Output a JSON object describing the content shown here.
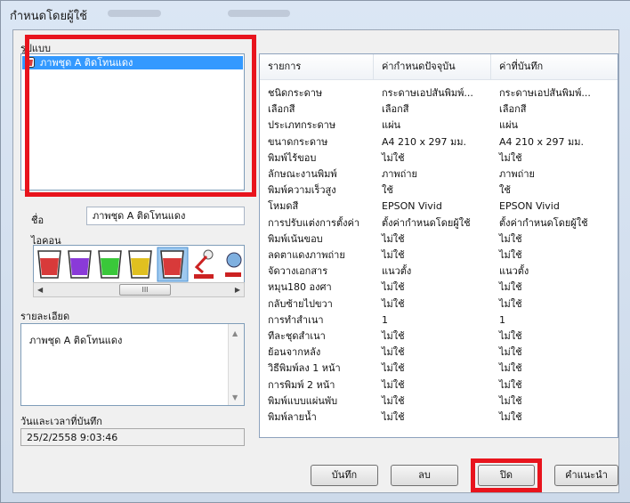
{
  "window": {
    "title": "กำหนดโดยผู้ใช้"
  },
  "format": {
    "label": "รูปแบบ",
    "items": [
      "ภาพชุด A ติดโทนแดง"
    ]
  },
  "name": {
    "label": "ชื่อ",
    "value": "ภาพชุด A ติดโทนแดง"
  },
  "icon": {
    "label": "ไอคอน",
    "colors": [
      "#d83a3a",
      "#8a3ad8",
      "#3ac83a",
      "#e0c020",
      "#d83a3a"
    ],
    "scroll_grip": "III"
  },
  "details": {
    "label": "รายละเอียด",
    "value": "ภาพชุด A ติดโทนแดง"
  },
  "saved": {
    "label": "วันและเวลาที่บันทึก",
    "value": "25/2/2558 9:03:46"
  },
  "table": {
    "headers": [
      "รายการ",
      "ค่ากำหนดปัจจุบัน",
      "ค่าที่บันทึก"
    ],
    "rows": [
      [
        "ชนิดกระดาษ",
        "กระดาษเอปสันพิมพ์...",
        "กระดาษเอปสันพิมพ์..."
      ],
      [
        "เลือกสี",
        "เลือกสี",
        "เลือกสี"
      ],
      [
        "ประเภทกระดาษ",
        "แผ่น",
        "แผ่น"
      ],
      [
        "ขนาดกระดาษ",
        "A4 210 x 297 มม.",
        "A4 210 x 297 มม."
      ],
      [
        "พิมพ์ไร้ขอบ",
        "ไม่ใช้",
        "ไม่ใช้"
      ],
      [
        "ลักษณะงานพิมพ์",
        "ภาพถ่าย",
        "ภาพถ่าย"
      ],
      [
        "พิมพ์ความเร็วสูง",
        "ใช้",
        "ใช้"
      ],
      [
        "โหมดสี",
        "EPSON Vivid",
        "EPSON Vivid"
      ],
      [
        "การปรับแต่งการตั้งค่า",
        "ตั้งค่ากำหนดโดยผู้ใช้",
        "ตั้งค่ากำหนดโดยผู้ใช้"
      ],
      [
        "พิมพ์เน้นขอบ",
        "ไม่ใช้",
        "ไม่ใช้"
      ],
      [
        "ลดตาแดงภาพถ่าย",
        "ไม่ใช้",
        "ไม่ใช้"
      ],
      [
        "จัดวางเอกสาร",
        "แนวตั้ง",
        "แนวตั้ง"
      ],
      [
        "หมุน180 องศา",
        "ไม่ใช้",
        "ไม่ใช้"
      ],
      [
        "กลับซ้ายไปขวา",
        "ไม่ใช้",
        "ไม่ใช้"
      ],
      [
        "การทำสำเนา",
        "1",
        "1"
      ],
      [
        "ทีละชุดสำเนา",
        "ไม่ใช้",
        "ไม่ใช้"
      ],
      [
        "ย้อนจากหลัง",
        "ไม่ใช้",
        "ไม่ใช้"
      ],
      [
        "วิธีพิมพ์ลง 1 หน้า",
        "ไม่ใช้",
        "ไม่ใช้"
      ],
      [
        "การพิมพ์ 2 หน้า",
        "ไม่ใช้",
        "ไม่ใช้"
      ],
      [
        "พิมพ์แบบแผ่นพับ",
        "ไม่ใช้",
        "ไม่ใช้"
      ],
      [
        "พิมพ์ลายน้ำ",
        "ไม่ใช้",
        "ไม่ใช้"
      ]
    ]
  },
  "buttons": {
    "save": "บันทึก",
    "delete": "ลบ",
    "close": "ปิด",
    "help": "คำแนะนำ"
  },
  "colors": {
    "highlight": "#e8141d",
    "selection": "#3399ff"
  }
}
